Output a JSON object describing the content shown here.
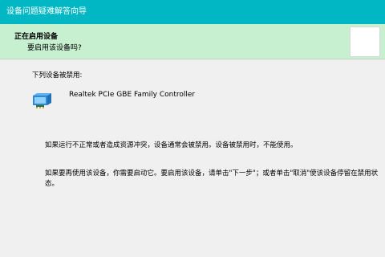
{
  "window": {
    "title": "设备问题疑难解答向导"
  },
  "header": {
    "title": "正在启用设备",
    "subtitle": "要启用该设备吗?"
  },
  "content": {
    "list_label": "下列设备被禁用:",
    "device": {
      "icon": "network-adapter-icon",
      "name": "Realtek PCIe GBE Family Controller"
    },
    "paragraph1": "如果运行不正常或者造成资源冲突，设备通常会被禁用。设备被禁用时，不能使用。",
    "paragraph2": "如果要再使用该设备，你需要启动它。要启用该设备，请单击\"下一步\"；或者单击\"取消\"使该设备停留在禁用状态。"
  },
  "colors": {
    "titlebar": "#00b7c3",
    "header_bg": "#c7f0d0",
    "content_bg": "#f0f0f0"
  }
}
